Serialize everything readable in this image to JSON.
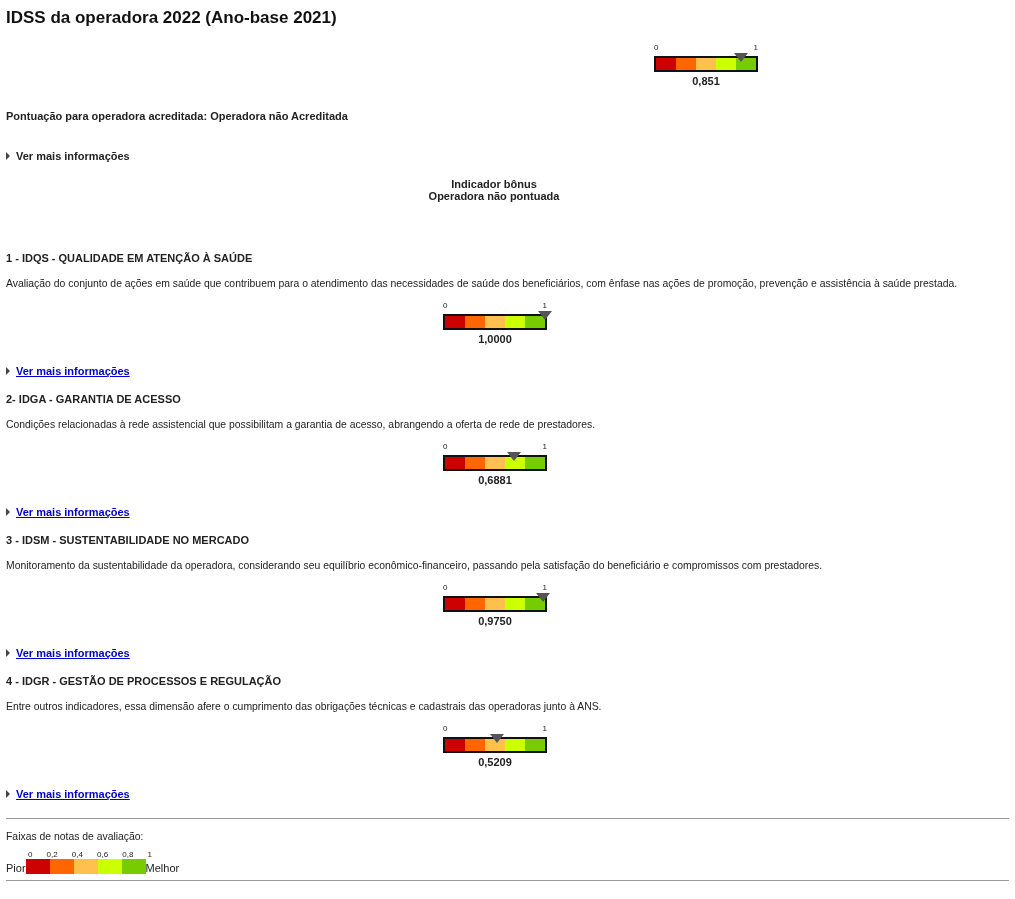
{
  "title": "IDSS da operadora 2022 (Ano-base 2021)",
  "main_gauge": {
    "min_label": "0",
    "max_label": "1",
    "level": 0.851,
    "reading": "0,851"
  },
  "accreditation": "Pontuação para operadora acreditada: Operadora não Acreditada",
  "more_info": {
    "label": "Ver mais informações",
    "expanded": false
  },
  "bonus": {
    "title": "Indicador bônus",
    "status": "Operadora não pontuada"
  },
  "sections": [
    {
      "heading": "1 - IDQS - QUALIDADE EM ATENÇÃO À SAÚDE",
      "description": "Avaliação do conjunto de ações em saúde que contribuem para o atendimento das necessidades de saúde dos beneficiários, com ênfase nas ações de promoção, prevenção e assistência à saúde prestada.",
      "gauge": {
        "min_label": "0",
        "max_label": "1",
        "level": 1.0,
        "reading": "1,0000"
      },
      "link": "Ver mais informações",
      "expanded": false
    },
    {
      "heading": "2- IDGA - GARANTIA DE ACESSO",
      "description": "Condições relacionadas à rede assistencial que possibilitam a garantia de acesso, abrangendo a oferta de rede de prestadores.",
      "gauge": {
        "min_label": "0",
        "max_label": "1",
        "level": 0.6881,
        "reading": "0,6881"
      },
      "link": "Ver mais informações",
      "expanded": false
    },
    {
      "heading": "3 - IDSM - SUSTENTABILIDADE NO MERCADO",
      "description": "Monitoramento da sustentabilidade da operadora, considerando seu equilíbrio econômico-financeiro, passando pela satisfação do beneficiário e compromissos com prestadores.",
      "gauge": {
        "min_label": "0",
        "max_label": "1",
        "level": 0.975,
        "reading": "0,9750"
      },
      "link": "Ver mais informações",
      "expanded": false
    },
    {
      "heading": "4 - IDGR - GESTÃO DE PROCESSOS E REGULAÇÃO",
      "description": "Entre outros indicadores, essa dimensão afere o cumprimento das obrigações técnicas e cadastrais das operadoras junto à ANS.",
      "gauge": {
        "min_label": "0",
        "max_label": "1",
        "level": 0.5209,
        "reading": "0,5209"
      },
      "link": "Ver mais informações",
      "expanded": false
    }
  ],
  "legend": {
    "title": "Faixas de notas de avaliação:",
    "ticks": [
      "0",
      "0,2",
      "0,4",
      "0,6",
      "0,8",
      "1"
    ],
    "bands": [
      {
        "color": "#cc0000"
      },
      {
        "color": "#ff6600"
      },
      {
        "color": "#ffc04d"
      },
      {
        "color": "#ccff00"
      },
      {
        "color": "#77cc00"
      }
    ],
    "worst_label": "Pior",
    "best_label": "Melhor"
  }
}
